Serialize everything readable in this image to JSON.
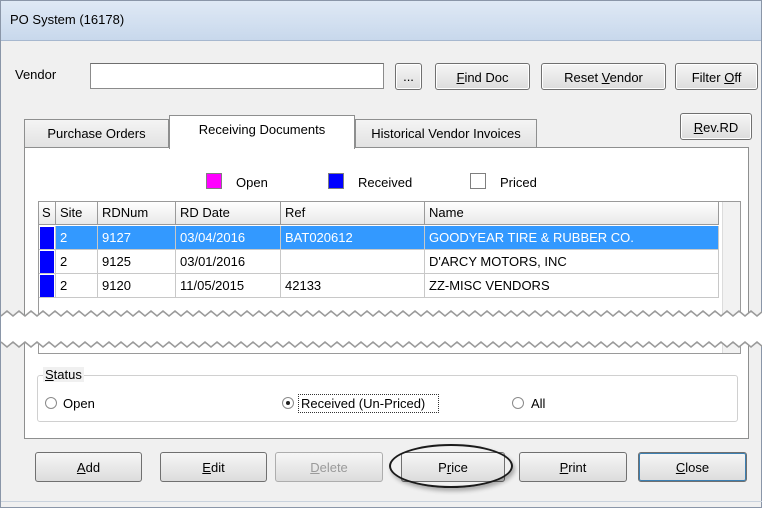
{
  "window": {
    "title": "PO System (16178)"
  },
  "vendor": {
    "label": "Vendor",
    "value": "",
    "browse_label": "..."
  },
  "toolbar": {
    "find_doc": {
      "pre": "",
      "key": "F",
      "post": "ind Doc"
    },
    "reset_vendor": {
      "pre": "Reset ",
      "key": "V",
      "post": "endor"
    },
    "filter_off": {
      "pre": "Filter ",
      "key": "O",
      "post": "ff"
    },
    "rev_rd": {
      "pre": "",
      "key": "R",
      "post": "ev.RD"
    }
  },
  "tabs": [
    {
      "label": "Purchase Orders",
      "active": false
    },
    {
      "label": "Receiving Documents",
      "active": true
    },
    {
      "label": "Historical Vendor Invoices",
      "active": false
    }
  ],
  "legend": [
    {
      "label": "Open",
      "color": "#ff00ff"
    },
    {
      "label": "Received",
      "color": "#0000ff"
    },
    {
      "label": "Priced",
      "color": "#ffffff"
    }
  ],
  "table": {
    "columns": [
      "S",
      "Site",
      "RDNum",
      "RD Date",
      "Ref",
      "Name"
    ],
    "rows": [
      {
        "site": "2",
        "rdnum": "9127",
        "date": "03/04/2016",
        "ref": "BAT020612",
        "name": "GOODYEAR TIRE & RUBBER CO.",
        "selected": true
      },
      {
        "site": "2",
        "rdnum": "9125",
        "date": "03/01/2016",
        "ref": "",
        "name": "D'ARCY MOTORS, INC",
        "selected": false
      },
      {
        "site": "2",
        "rdnum": "9120",
        "date": "11/05/2015",
        "ref": "42133",
        "name": "ZZ-MISC VENDORS",
        "selected": false
      }
    ]
  },
  "status": {
    "title": {
      "pre": "",
      "key": "S",
      "post": "tatus"
    },
    "options": [
      {
        "label": "Open",
        "selected": false
      },
      {
        "label": "Received (Un-Priced)",
        "selected": true
      },
      {
        "label": "All",
        "selected": false
      }
    ]
  },
  "actions": {
    "add": {
      "pre": "",
      "key": "A",
      "post": "dd"
    },
    "edit": {
      "pre": "",
      "key": "E",
      "post": "dit"
    },
    "delete": {
      "pre": "",
      "key": "D",
      "post": "elete"
    },
    "price": {
      "pre": "P",
      "key": "r",
      "post": "ice"
    },
    "print": {
      "pre": "",
      "key": "P",
      "post": "rint"
    },
    "close": {
      "pre": "",
      "key": "C",
      "post": "lose"
    }
  }
}
